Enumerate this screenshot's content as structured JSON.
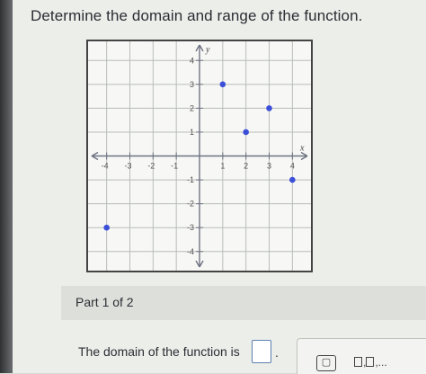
{
  "question": {
    "text": "Determine the domain and range of the function."
  },
  "graph": {
    "x_axis_label": "x",
    "y_axis_label": "y",
    "x_tick_labels": [
      "-4",
      "-3",
      "-2",
      "-1",
      "1",
      "2",
      "3",
      "4"
    ],
    "y_tick_labels": [
      "4",
      "3",
      "2",
      "1",
      "-1",
      "-2",
      "-3",
      "-4"
    ],
    "xlim": [
      -4.8,
      4.8
    ],
    "ylim": [
      -4.8,
      4.8
    ],
    "grid": true,
    "point_color": "#3b4fd8"
  },
  "chart_data": {
    "type": "scatter",
    "points": [
      {
        "x": -4,
        "y": -3
      },
      {
        "x": 1,
        "y": 3
      },
      {
        "x": 2,
        "y": 1
      },
      {
        "x": 3,
        "y": 2
      },
      {
        "x": 4,
        "y": -1
      }
    ],
    "xlim": [
      -4.8,
      4.8
    ],
    "ylim": [
      -4.8,
      4.8
    ],
    "grid": true
  },
  "part": {
    "label": "Part 1 of 2"
  },
  "answer": {
    "prompt": "The domain of the function is",
    "period": ".",
    "tool_set_label": "{□}",
    "tool_list_label": "□,□,..."
  }
}
